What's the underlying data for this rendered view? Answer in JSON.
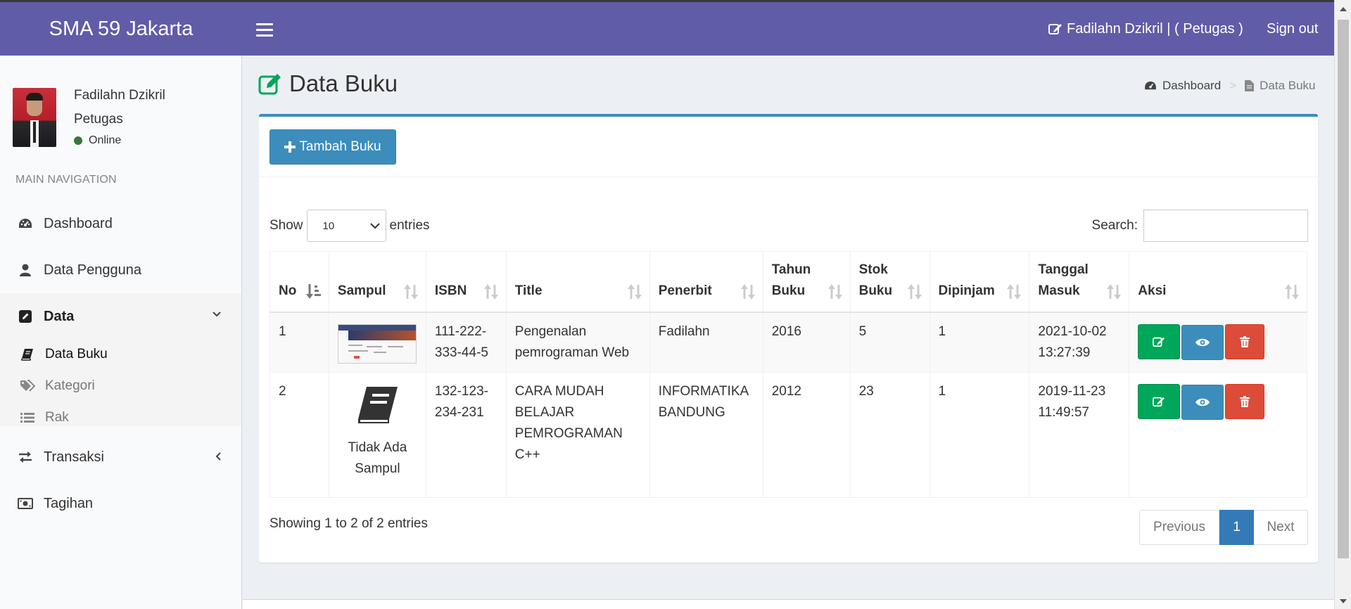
{
  "header": {
    "app_title": "SMA 59 Jakarta",
    "user_label": "Fadilahn Dzikril | ( Petugas )",
    "signout_label": "Sign out",
    "brand_color": "#605ca8"
  },
  "sidebar": {
    "user": {
      "name": "Fadilahn Dzikril",
      "role": "Petugas",
      "status": "Online"
    },
    "nav_header": "MAIN NAVIGATION",
    "items": [
      {
        "label": "Dashboard",
        "icon": "dashboard-icon"
      },
      {
        "label": "Data Pengguna",
        "icon": "user-icon"
      },
      {
        "label": "Data",
        "icon": "edit-square-icon",
        "expanded": true
      },
      {
        "label": "Transaksi",
        "icon": "exchange-icon",
        "expanded": false
      },
      {
        "label": "Tagihan",
        "icon": "money-icon"
      }
    ],
    "sub_items": [
      {
        "label": "Data Buku",
        "icon": "book-icon",
        "current": true
      },
      {
        "label": "Kategori",
        "icon": "tags-icon"
      },
      {
        "label": "Rak",
        "icon": "list-icon"
      }
    ]
  },
  "page": {
    "title": "Data Buku",
    "breadcrumb": {
      "home": "Dashboard",
      "current": "Data Buku"
    }
  },
  "toolbar": {
    "add_label": "Tambah Buku"
  },
  "table_controls": {
    "show_label": "Show",
    "page_size": "10",
    "entries_label": "entries",
    "search_label": "Search:",
    "search_value": ""
  },
  "table": {
    "columns": [
      {
        "line1": "No",
        "line2": ""
      },
      {
        "line1": "Sampul",
        "line2": ""
      },
      {
        "line1": "ISBN",
        "line2": ""
      },
      {
        "line1": "Title",
        "line2": ""
      },
      {
        "line1": "Penerbit",
        "line2": ""
      },
      {
        "line1": "Tahun",
        "line2": "Buku"
      },
      {
        "line1": "Stok",
        "line2": "Buku"
      },
      {
        "line1": "Dipinjam",
        "line2": ""
      },
      {
        "line1": "Tanggal",
        "line2": "Masuk"
      },
      {
        "line1": "Aksi",
        "line2": ""
      }
    ],
    "rows": [
      {
        "no": "1",
        "cover": "thumbnail",
        "isbn": "111-222-333-44-5",
        "title": "Pengenalan pemrograman Web",
        "publisher": "Fadilahn",
        "year": "2016",
        "stock": "5",
        "borrowed": "1",
        "date": "2021-10-02",
        "time": "13:27:39"
      },
      {
        "no": "2",
        "cover": "none",
        "cover_text": "Tidak Ada Sampul",
        "isbn": "132-123-234-231",
        "title": "CARA MUDAH BELAJAR PEMROGRAMAN C++",
        "publisher": "INFORMATIKA BANDUNG",
        "year": "2012",
        "stock": "23",
        "borrowed": "1",
        "date": "2019-11-23",
        "time": "11:49:57"
      }
    ]
  },
  "footer_controls": {
    "info": "Showing 1 to 2 of 2 entries",
    "prev": "Previous",
    "current_page": "1",
    "next": "Next"
  },
  "colors": {
    "primary": "#3c8dbc",
    "success": "#00a65a",
    "danger": "#dd4b39",
    "online": "#3c763d"
  }
}
